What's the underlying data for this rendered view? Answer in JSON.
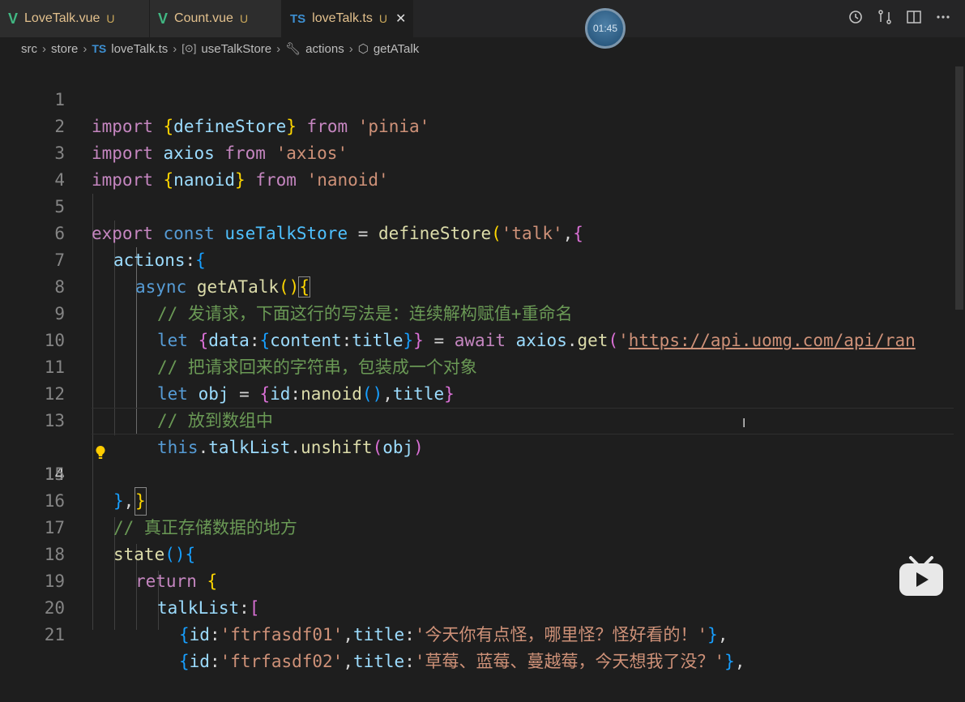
{
  "tabs": [
    {
      "name": "LoveTalk.vue",
      "mod": "U",
      "type": "vue"
    },
    {
      "name": "Count.vue",
      "mod": "U",
      "type": "vue"
    },
    {
      "name": "loveTalk.ts",
      "mod": "U",
      "type": "ts",
      "active": true
    }
  ],
  "timer": "01:45",
  "breadcrumb": {
    "src": "src",
    "store": "store",
    "file_icon": "TS",
    "file": "loveTalk.ts",
    "symbol1": "useTalkStore",
    "symbol2": "actions",
    "symbol3": "getATalk"
  },
  "icons": {
    "vue_tab": "V",
    "ts_tab": "TS",
    "close": "✕",
    "text_cursor": "I"
  },
  "editor": {
    "current_line": 14,
    "lines": [
      {
        "n": "1"
      },
      {
        "n": "2"
      },
      {
        "n": "3"
      },
      {
        "n": "4"
      },
      {
        "n": "5"
      },
      {
        "n": "6"
      },
      {
        "n": "7"
      },
      {
        "n": "8"
      },
      {
        "n": "9"
      },
      {
        "n": "10"
      },
      {
        "n": "11"
      },
      {
        "n": "12"
      },
      {
        "n": "13"
      },
      {
        "n": "14"
      },
      {
        "n": "15"
      },
      {
        "n": "16"
      },
      {
        "n": "17"
      },
      {
        "n": "18"
      },
      {
        "n": "19"
      },
      {
        "n": "20"
      },
      {
        "n": "21"
      }
    ],
    "code": {
      "l1": [
        "import ",
        "{",
        "defineStore",
        "}",
        " from ",
        "'pinia'"
      ],
      "l2": [
        "import ",
        "axios",
        " from ",
        "'axios'"
      ],
      "l3": [
        "import ",
        "{",
        "nanoid",
        "}",
        " from ",
        "'nanoid'"
      ],
      "l5": [
        "export ",
        "const ",
        "useTalkStore",
        " = ",
        "defineStore",
        "(",
        "'talk'",
        ",",
        "{"
      ],
      "l6": [
        "actions",
        ":",
        "{"
      ],
      "l7": [
        "async ",
        "getATalk",
        "(",
        ")",
        "{"
      ],
      "l8": "// 发请求，下面这行的写法是：连续解构赋值+重命名",
      "l9": [
        "let ",
        "{",
        "data",
        ":",
        "{",
        "content",
        ":",
        "title",
        "}",
        "}",
        " = ",
        "await ",
        "axios",
        ".",
        "get",
        "(",
        "'",
        "https://api.uomg.com/api/ran"
      ],
      "l10": "// 把请求回来的字符串，包装成一个对象",
      "l11": [
        "let ",
        "obj",
        " = ",
        "{",
        "id",
        ":",
        "nanoid",
        "(",
        ")",
        ",",
        "title",
        "}"
      ],
      "l12": "// 放到数组中",
      "l13": [
        "this",
        ".",
        "talkList",
        ".",
        "unshift",
        "(",
        "obj",
        ")"
      ],
      "l14": "}",
      "l15": [
        "}",
        ","
      ],
      "l16": "// 真正存储数据的地方",
      "l17": [
        "state",
        "(",
        ")",
        "{"
      ],
      "l18": [
        "return ",
        "{"
      ],
      "l19": [
        "talkList",
        ":",
        "["
      ],
      "l20": [
        "{",
        "id",
        ":",
        "'ftrfasdf01'",
        ",",
        "title",
        ":",
        "'今天你有点怪，哪里怪？怪好看的！'",
        "}",
        ","
      ],
      "l21": [
        "{",
        "id",
        ":",
        "'ftrfasdf02'",
        ",",
        "title",
        ":",
        "'草莓、蓝莓、蔓越莓，今天想我了没？'",
        "}",
        ","
      ]
    }
  }
}
